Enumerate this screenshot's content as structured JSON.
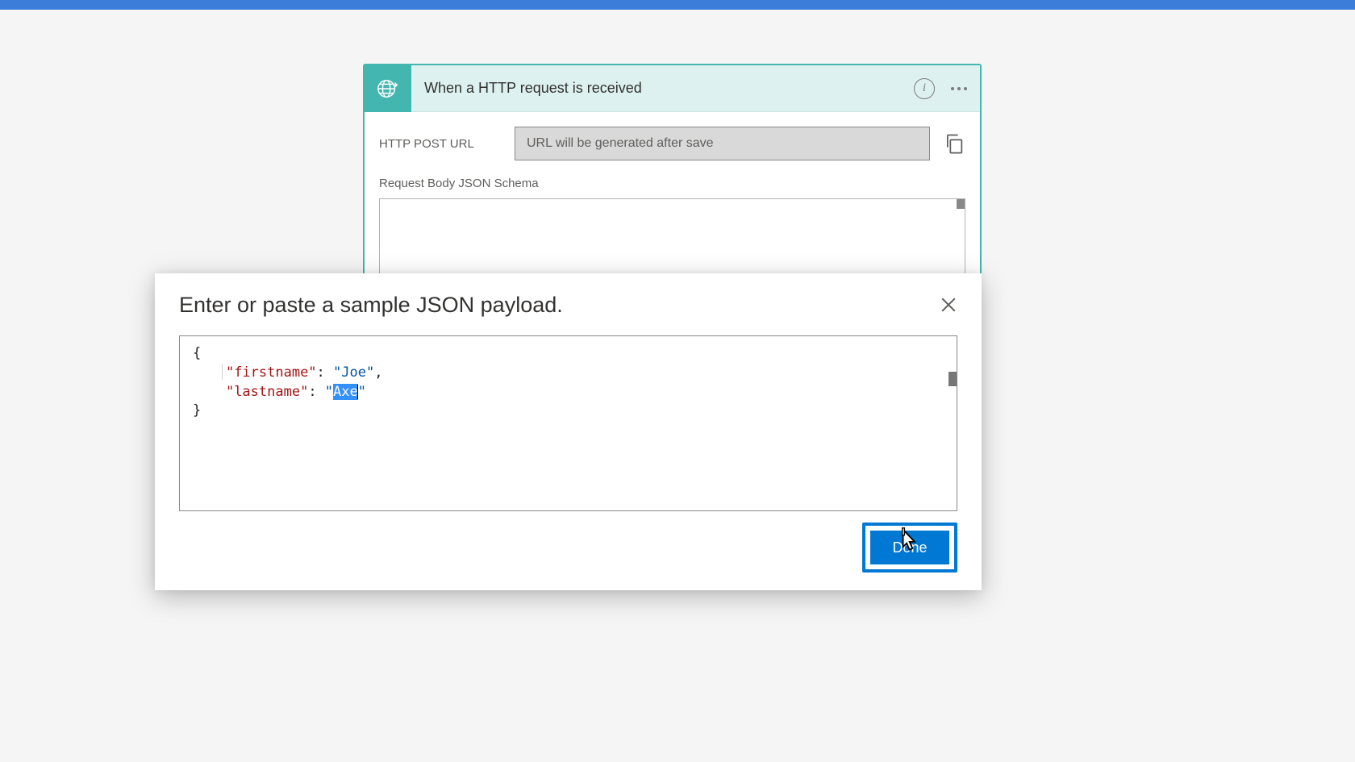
{
  "trigger": {
    "title": "When a HTTP request is received",
    "postUrlLabel": "HTTP POST URL",
    "postUrlValue": "URL will be generated after save",
    "schemaLabel": "Request Body JSON Schema"
  },
  "modal": {
    "title": "Enter or paste a sample JSON payload.",
    "doneLabel": "Done",
    "json": {
      "open": "{",
      "key1": "\"firstname\"",
      "colon": ": ",
      "val1": "\"Joe\"",
      "comma": ",",
      "key2": "\"lastname\"",
      "val2open": "\"",
      "val2sel": "Axe",
      "val2close": "\"",
      "close": "}"
    }
  }
}
